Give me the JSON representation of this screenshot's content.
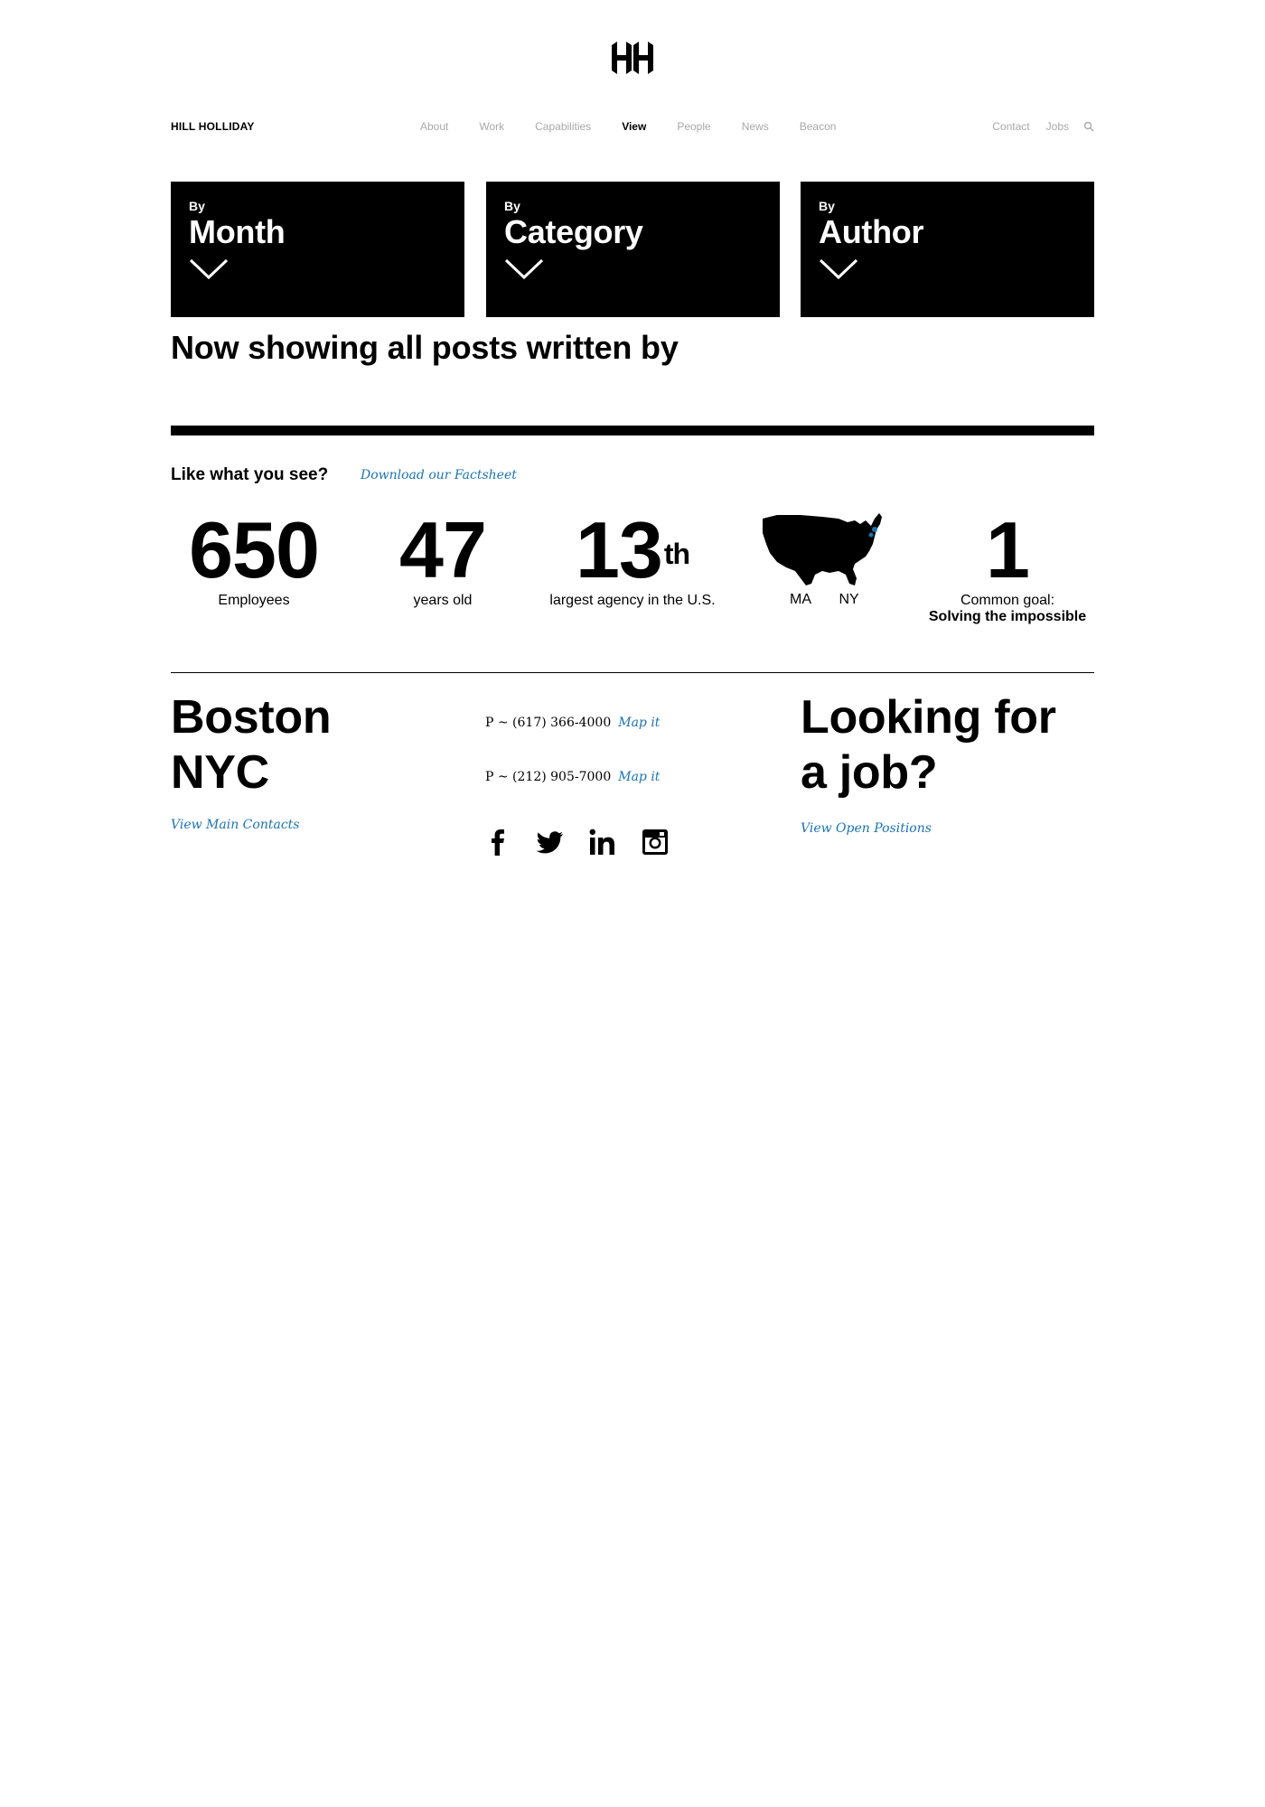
{
  "header": {
    "logo_icon": "hh-monogram-icon",
    "brand": "HILL HOLLIDAY",
    "nav": [
      "About",
      "Work",
      "Capabilities",
      "View",
      "People",
      "News",
      "Beacon"
    ],
    "active_nav": "View",
    "nav_right": [
      "Contact",
      "Jobs"
    ],
    "search_icon": "search-icon"
  },
  "filters": [
    {
      "by": "By",
      "label": "Month",
      "icon": "chevron-down-icon"
    },
    {
      "by": "By",
      "label": "Category",
      "icon": "chevron-down-icon"
    },
    {
      "by": "By",
      "label": "Author",
      "icon": "chevron-down-icon"
    }
  ],
  "heading": "Now showing all posts written by",
  "cta": {
    "like": "Like what you see?",
    "factsheet": "Download our Factsheet"
  },
  "stats": {
    "employees": {
      "num": "650",
      "label": "Employees"
    },
    "years": {
      "num": "47",
      "label": "years old"
    },
    "rank": {
      "num": "13",
      "suffix": "th",
      "label": "largest agency in the U.S."
    },
    "map": {
      "icon": "usa-map-icon",
      "labels": [
        "MA",
        "NY"
      ]
    },
    "goal": {
      "num": "1",
      "label": "Common goal:",
      "label_bold": "Solving the impossible"
    }
  },
  "footer": {
    "cities": [
      "Boston",
      "NYC"
    ],
    "main_contacts": "View Main Contacts",
    "phones": [
      {
        "text": "P ~ (617) 366-4000",
        "map": "Map it"
      },
      {
        "text": "P ~ (212) 905-7000",
        "map": "Map it"
      }
    ],
    "socials": [
      "facebook-icon",
      "twitter-icon",
      "linkedin-icon",
      "instagram-icon"
    ],
    "job_heading_line1": "Looking for",
    "job_heading_line2": "a job?",
    "positions": "View Open Positions"
  },
  "colors": {
    "accent": "#1b74b3",
    "text": "#000000",
    "nav_inactive": "#a9a9a9"
  }
}
